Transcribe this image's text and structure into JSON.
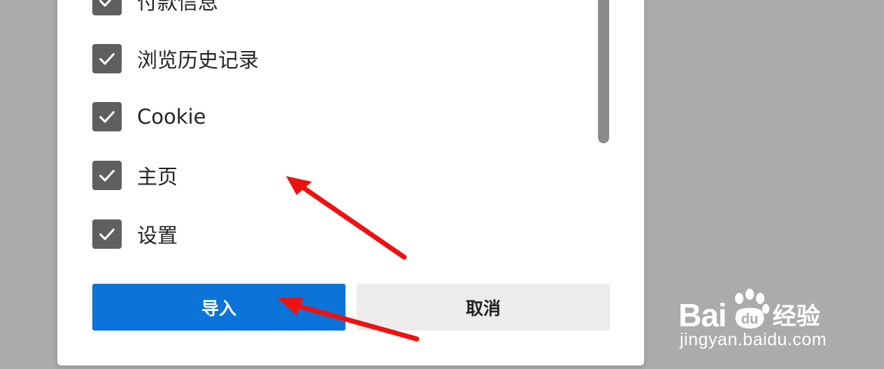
{
  "dialog": {
    "items": [
      {
        "label": "付款信息",
        "checked": true
      },
      {
        "label": "浏览历史记录",
        "checked": true
      },
      {
        "label": "Cookie",
        "checked": true
      },
      {
        "label": "主页",
        "checked": true
      },
      {
        "label": "设置",
        "checked": true
      }
    ],
    "buttons": {
      "import_label": "导入",
      "cancel_label": "取消"
    }
  },
  "watermark": {
    "brand_bai": "Bai",
    "brand_du": "du",
    "brand_jingyan": "经验",
    "domain": "jingyan.baidu.com"
  },
  "colors": {
    "primary": "#0c74d8",
    "annotation_arrow": "#ee1111",
    "checkbox": "#5f5f5f",
    "backdrop": "#ababab"
  },
  "icons": {
    "checkbox": "checkmark-icon",
    "annotation": "red-arrow-icon",
    "watermark": "baidu-paw-icon"
  }
}
